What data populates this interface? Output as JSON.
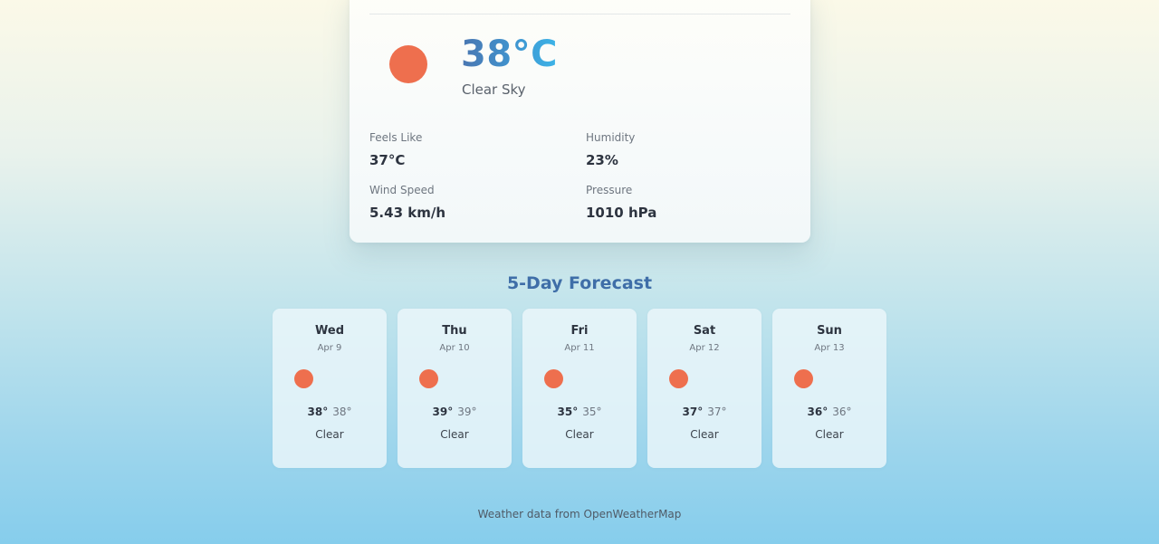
{
  "current": {
    "icon": "sun-icon",
    "temperature": "38°C",
    "description": "Clear Sky",
    "stats": {
      "feels_like": {
        "label": "Feels Like",
        "value": "37°C"
      },
      "humidity": {
        "label": "Humidity",
        "value": "23%"
      },
      "wind_speed": {
        "label": "Wind Speed",
        "value": "5.43 km/h"
      },
      "pressure": {
        "label": "Pressure",
        "value": "1010 hPa"
      }
    }
  },
  "forecast": {
    "title": "5-Day Forecast",
    "days": [
      {
        "day": "Wed",
        "date": "Apr 9",
        "icon": "sun-icon",
        "high": "38°",
        "low": "38°",
        "condition": "Clear"
      },
      {
        "day": "Thu",
        "date": "Apr 10",
        "icon": "sun-icon",
        "high": "39°",
        "low": "39°",
        "condition": "Clear"
      },
      {
        "day": "Fri",
        "date": "Apr 11",
        "icon": "sun-icon",
        "high": "35°",
        "low": "35°",
        "condition": "Clear"
      },
      {
        "day": "Sat",
        "date": "Apr 12",
        "icon": "sun-icon",
        "high": "37°",
        "low": "37°",
        "condition": "Clear"
      },
      {
        "day": "Sun",
        "date": "Apr 13",
        "icon": "sun-icon",
        "high": "36°",
        "low": "36°",
        "condition": "Clear"
      }
    ]
  },
  "footer": {
    "attribution": "Weather data from OpenWeatherMap"
  },
  "colors": {
    "sun": "#ee6f4e",
    "accent": "#3f6ea8",
    "temp_gradient_start": "#4a76b1",
    "temp_gradient_end": "#3cb4e8"
  }
}
